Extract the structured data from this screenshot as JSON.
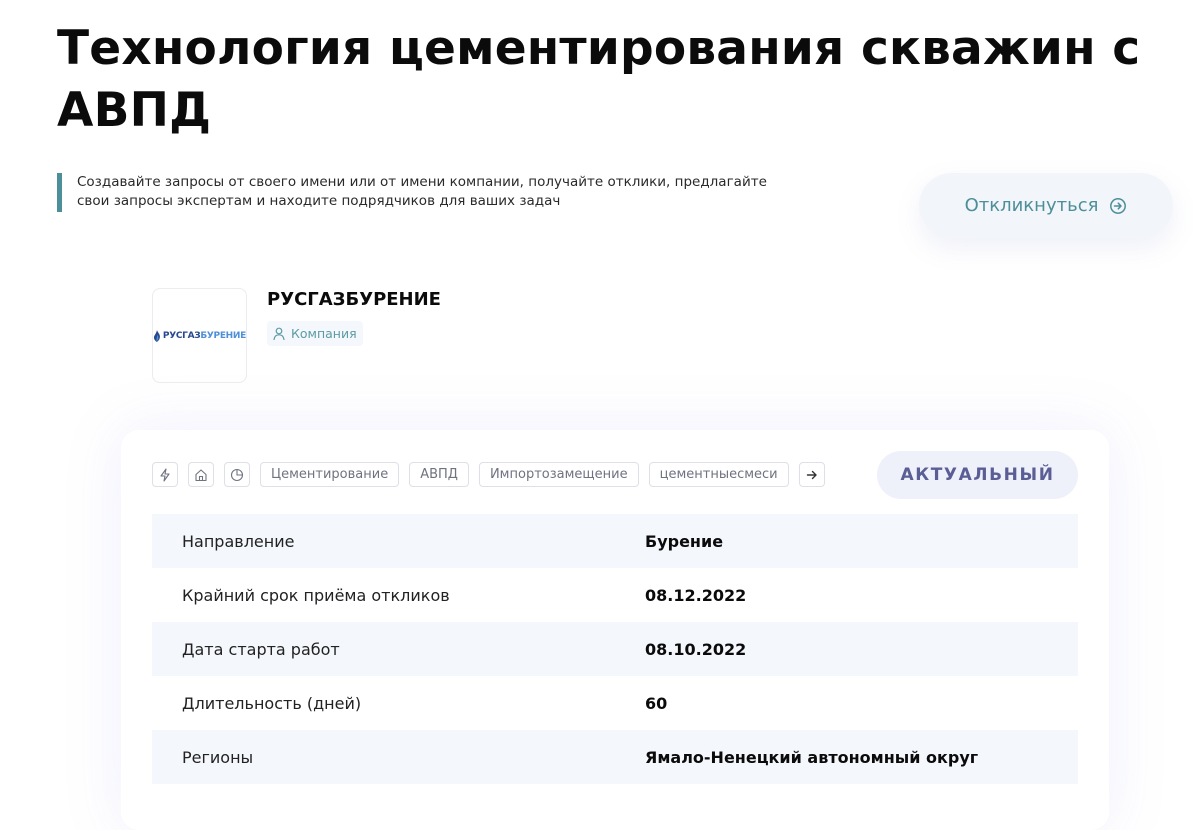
{
  "page": {
    "title": "Технология цементирования скважин с АВПД",
    "intro": "Создавайте запросы от своего имени или от имени компании, получайте отклики, предлагайте свои запросы экспертам и находите подрядчиков для ваших задач",
    "respond_label": "Откликнуться"
  },
  "company": {
    "name": "РУСГАЗБУРЕНИЕ",
    "logo_text_a": "РУСГАЗ",
    "logo_text_b": "БУРЕНИЕ",
    "badge_label": "Компания"
  },
  "request": {
    "tags": [
      "Цементирование",
      "АВПД",
      "Импортозамещение",
      "цементныесмеси"
    ],
    "status": "АКТУАЛЬНЫЙ",
    "details": [
      {
        "label": "Направление",
        "value": "Бурение"
      },
      {
        "label": "Крайний срок приёма откликов",
        "value": "08.12.2022"
      },
      {
        "label": "Дата старта работ",
        "value": "08.10.2022"
      },
      {
        "label": "Длительность (дней)",
        "value": "60"
      },
      {
        "label": "Регионы",
        "value": "Ямало-Ненецкий автономный округ"
      }
    ]
  },
  "icons": {
    "respond": "arrow-circle-right-icon",
    "badge": "user-icon",
    "tag_icons": [
      "lightning-icon",
      "home-icon",
      "pie-chart-icon"
    ],
    "tags_more": "arrow-right-icon"
  },
  "colors": {
    "accent_teal": "#4d8f98",
    "status_text": "#5b5d95",
    "status_bg": "#eef0fa",
    "row_stripe": "#f4f7fb"
  }
}
